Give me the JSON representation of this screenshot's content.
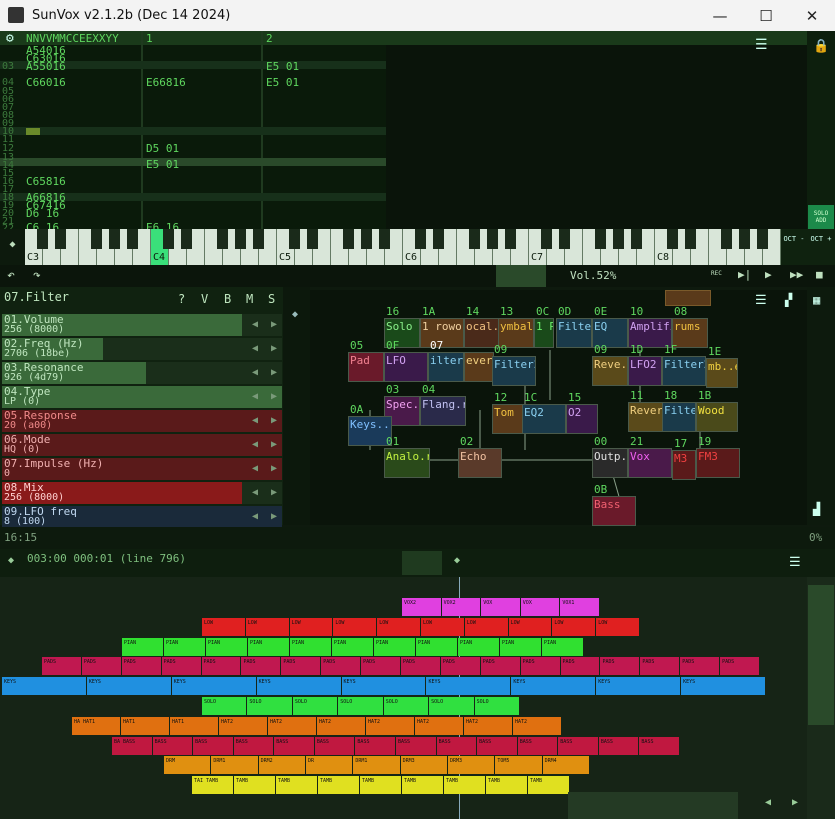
{
  "window": {
    "title": "SunVox v2.1.2b (Dec 14 2024)",
    "minimize": "—",
    "maximize": "☐",
    "close": "✕"
  },
  "pattern": {
    "header_label": "NNVVMMCCEEXXYY",
    "track2_label": "1",
    "track3_label": "2",
    "rows": [
      {
        "num": "",
        "t1": "A54016",
        "t2": "",
        "t3": ""
      },
      {
        "num": "",
        "t1": "C63016",
        "t2": "",
        "t3": ""
      },
      {
        "num": "03",
        "t1": "A55016",
        "t2": "",
        "t3": "E5  01"
      },
      {
        "num": "04",
        "t1": "C66016",
        "t2": "E66816",
        "t3": "E5  01"
      }
    ],
    "rows2": [
      {
        "num": "12",
        "t2": "D5  01"
      },
      {
        "num": "14",
        "t2": "E5  01"
      },
      {
        "num": "16",
        "t1": "C65816"
      },
      {
        "num": "18",
        "t1": "A66816"
      },
      {
        "num": "19",
        "t1": "C67416"
      },
      {
        "num": "20",
        "t1": "D6  16"
      },
      {
        "num": "22",
        "t1": "C6  16",
        "t2": "E6  16"
      }
    ],
    "rownums": [
      "05",
      "06",
      "07",
      "08",
      "09",
      "10",
      "11",
      "13",
      "15",
      "17",
      "21",
      "23"
    ],
    "solo_label": "SOLO ADD"
  },
  "keyboard": {
    "octaves": [
      "C3",
      "C4",
      "C5",
      "C6",
      "C7",
      "C8"
    ],
    "oct_minus": "OCT -",
    "oct_plus": "OCT +"
  },
  "toolbar": {
    "volume": "Vol.52%",
    "rec": "REC"
  },
  "module": {
    "name": "07.Filter",
    "tools": [
      "?",
      "V",
      "B",
      "M",
      "S"
    ],
    "params": [
      {
        "name": "01.Volume",
        "value": "256 (8000)",
        "fill": 1.0,
        "color": "#3a6a3a",
        "tcolor": "#bfe6bf"
      },
      {
        "name": "02.Freq (Hz)",
        "value": "2706 (18be)",
        "fill": 0.42,
        "color": "#3a6a3a",
        "tcolor": "#bfe6bf"
      },
      {
        "name": "03.Resonance",
        "value": "926 (4d79)",
        "fill": 0.6,
        "color": "#3a6a3a",
        "tcolor": "#bfe6bf"
      },
      {
        "name": "04.Type",
        "value": "LP (0)",
        "fill": 0,
        "color": "#3a6a3a",
        "tcolor": "#bfe6bf"
      },
      {
        "name": "05.Response",
        "value": "20 (a00)",
        "fill": 0,
        "color": "#5a1a1a",
        "tcolor": "#f08a8a"
      },
      {
        "name": "06.Mode",
        "value": "HQ (0)",
        "fill": 0,
        "color": "#5a1a1a",
        "tcolor": "#f0b0b0"
      },
      {
        "name": "07.Impulse (Hz)",
        "value": "0",
        "fill": 0,
        "color": "#5a1a1a",
        "tcolor": "#f0b0b0"
      },
      {
        "name": "08.Mix",
        "value": "256 (8000)",
        "fill": 1.0,
        "color": "#8a1a1a",
        "tcolor": "#ffd0d0"
      },
      {
        "name": "09.LFO freq",
        "value": "8 (100)",
        "fill": 0,
        "color": "#1a2a3a",
        "tcolor": "#c0d8f0"
      }
    ]
  },
  "modules": [
    {
      "num": "16",
      "label": "Solo",
      "bg": "#1a4a1a",
      "fg": "#8af08a"
    },
    {
      "num": "1A",
      "label": "1 rowo",
      "bg": "#5a3a1a",
      "fg": "#f0d0a0"
    },
    {
      "num": "14",
      "label": "ocal.r",
      "bg": "#4a2a1a",
      "fg": "#f0c080"
    },
    {
      "num": "13",
      "label": "ymbal",
      "bg": "#5a3a1a",
      "fg": "#f0c040"
    },
    {
      "num": "0C",
      "label": "1 P",
      "bg": "#1a4a1a",
      "fg": "#6af06a"
    },
    {
      "num": "0D",
      "label": "Filter",
      "bg": "#1a3a4a",
      "fg": "#8ad0f0"
    },
    {
      "num": "0E",
      "label": "EQ",
      "bg": "#1a3a4a",
      "fg": "#8ad0f0"
    },
    {
      "num": "10",
      "label": "Amplifi",
      "bg": "#3a1a4a",
      "fg": "#d0a0f0"
    },
    {
      "num": "08",
      "label": "rums",
      "bg": "#5a3a1a",
      "fg": "#f0c040"
    },
    {
      "num": "05",
      "label": "Pad",
      "bg": "#6a1a2a",
      "fg": "#f08090"
    },
    {
      "num": "0F",
      "label": "LFO",
      "bg": "#3a1a4a",
      "fg": "#d0a0f0"
    },
    {
      "num": "07",
      "label": "ilter",
      "bg": "#1a3a4a",
      "fg": "#8ad0f0"
    },
    {
      "num": "",
      "label": "ever",
      "bg": "#5a3a1a",
      "fg": "#f0d080"
    },
    {
      "num": "09",
      "label": "Filter2",
      "bg": "#1a3a4a",
      "fg": "#8ad0f0"
    },
    {
      "num": "09",
      "label": "Reve..",
      "bg": "#5a4a1a",
      "fg": "#f0d080"
    },
    {
      "num": "1D",
      "label": "LFO2",
      "bg": "#3a1a4a",
      "fg": "#d0a0f0"
    },
    {
      "num": "1F",
      "label": "Filter2",
      "bg": "#1a3a4a",
      "fg": "#8ad0f0"
    },
    {
      "num": "1E",
      "label": "mb..e",
      "bg": "#5a4a1a",
      "fg": "#f0d040"
    },
    {
      "num": "03",
      "label": "Spec..",
      "bg": "#4a1a4a",
      "fg": "#f0a0f0"
    },
    {
      "num": "04",
      "label": "Flang.r",
      "bg": "#2a2a4a",
      "fg": "#c0c0f0"
    },
    {
      "num": "12",
      "label": "Tom",
      "bg": "#5a3a1a",
      "fg": "#f0c040"
    },
    {
      "num": "1C",
      "label": "EQ2",
      "bg": "#1a3a4a",
      "fg": "#8ad0f0"
    },
    {
      "num": "15",
      "label": "O2",
      "bg": "#3a1a4a",
      "fg": "#d0a0f0"
    },
    {
      "num": "11",
      "label": "Rever",
      "bg": "#5a4a1a",
      "fg": "#f0d080"
    },
    {
      "num": "18",
      "label": "Filte",
      "bg": "#1a3a4a",
      "fg": "#8ad0f0"
    },
    {
      "num": "1B",
      "label": "Wood",
      "bg": "#4a4a1a",
      "fg": "#f0e040"
    },
    {
      "num": "0A",
      "label": "Keys..1",
      "bg": "#1a3a5a",
      "fg": "#80c0ff"
    },
    {
      "num": "01",
      "label": "Analo.r",
      "bg": "#2a4a1a",
      "fg": "#c0f040"
    },
    {
      "num": "02",
      "label": "Echo",
      "bg": "#5a3a2a",
      "fg": "#f0c0a0"
    },
    {
      "num": "00",
      "label": "Outp..",
      "bg": "#2a2a2a",
      "fg": "#e0e0e0"
    },
    {
      "num": "21",
      "label": "Vox",
      "bg": "#4a1a4a",
      "fg": "#f060f0"
    },
    {
      "num": "17",
      "label": "M3",
      "bg": "#5a1a1a",
      "fg": "#f04040"
    },
    {
      "num": "19",
      "label": "FM3",
      "bg": "#5a1a1a",
      "fg": "#f04040"
    },
    {
      "num": "0B",
      "label": "Bass",
      "bg": "#6a1a2a",
      "fg": "#f06070"
    }
  ],
  "status": {
    "time": "16:15",
    "cpu": "0%"
  },
  "timeline": {
    "position": "003:00  000:01  (line 796)",
    "tracks": [
      {
        "color": "#e040e0",
        "labels": [
          "VOX2",
          "VOX2",
          "VOX",
          "VOX",
          "VOX1"
        ]
      },
      {
        "color": "#e02020",
        "labels": [
          "LOW",
          "LOW",
          "LOW",
          "LOW",
          "LOW",
          "LOW",
          "LOW",
          "LOW",
          "LOW",
          "LOW"
        ]
      },
      {
        "color": "#30e030",
        "labels": [
          "PIAN",
          "PIAN",
          "PIAN",
          "PIAN",
          "PIAN",
          "PIAN",
          "PIAN",
          "PIAN",
          "PIAN",
          "PIAN",
          "PIAN"
        ]
      },
      {
        "color": "#c01850",
        "labels": [
          "PADS",
          "PADS",
          "PADS",
          "PADS",
          "PADS",
          "PADS",
          "PADS",
          "PADS",
          "PADS",
          "PADS",
          "PADS",
          "PADS",
          "PADS",
          "PADS",
          "PADS",
          "PADS",
          "PADS",
          "PADS"
        ]
      },
      {
        "color": "#2090e0",
        "labels": [
          "KEYS",
          "KEYS",
          "KEYS",
          "KEYS",
          "KEYS",
          "KEYS",
          "KEYS",
          "KEYS",
          "KEYS"
        ]
      },
      {
        "color": "#30e040",
        "labels": [
          "SOLO",
          "SOLO",
          "SOLO",
          "SOLO",
          "SOLO",
          "SOLO",
          "SOLO"
        ]
      },
      {
        "color": "#e07010",
        "labels": [
          "HA HAT1",
          "HAT1",
          "HAT1",
          "HAT2",
          "HAT2",
          "HAT2",
          "HAT2",
          "HAT2",
          "HAT2",
          "HAT2"
        ]
      },
      {
        "color": "#c01840",
        "labels": [
          "BA BASS",
          "BASS",
          "BASS",
          "BASS",
          "BASS",
          "BASS",
          "BASS",
          "BASS",
          "BASS",
          "BASS",
          "BASS",
          "BASS",
          "BASS",
          "BASS"
        ]
      },
      {
        "color": "#e09010",
        "labels": [
          "DRM",
          "DRM1",
          "DRM2",
          "DR",
          "DRM1",
          "DRM3",
          "DRM3",
          "TOM5",
          "DRM4"
        ]
      },
      {
        "color": "#e0e020",
        "labels": [
          "TAI TAMB",
          "TAMB",
          "TAMB",
          "TAMB",
          "TAMB",
          "TAMB",
          "TAMB",
          "TAMB",
          "TAMB"
        ]
      }
    ]
  },
  "colors": {
    "accent": "#5fd75f",
    "background": "#0e1a0e"
  }
}
